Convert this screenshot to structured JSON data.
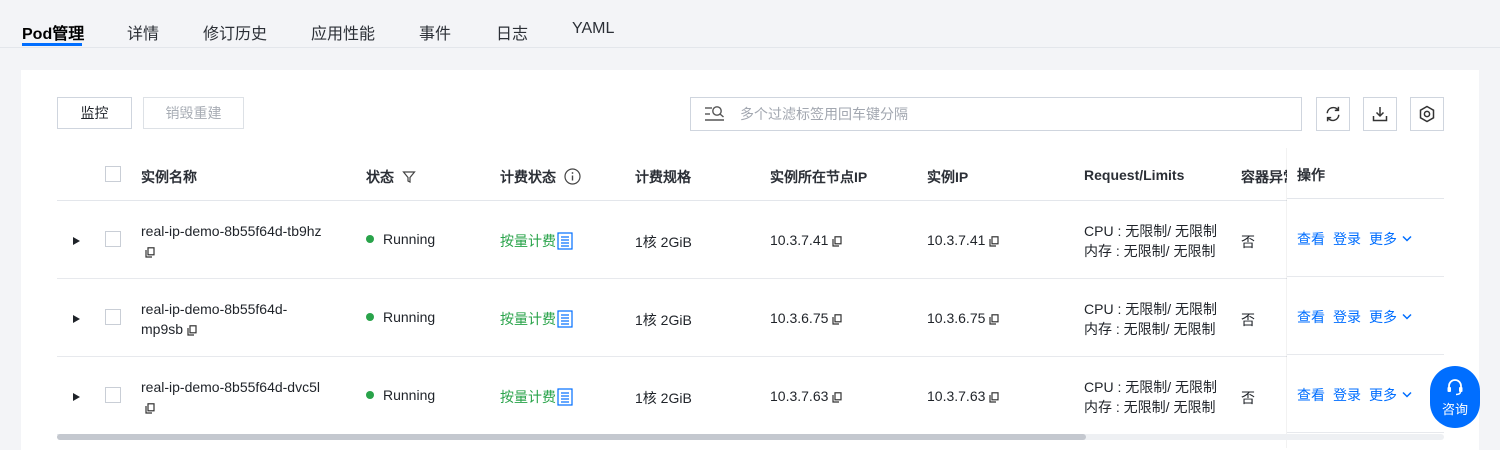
{
  "tabs": [
    "Pod管理",
    "详情",
    "修订历史",
    "应用性能",
    "事件",
    "日志",
    "YAML"
  ],
  "toolbar": {
    "monitor_label": "监控",
    "destroy_label": "销毁重建",
    "search_placeholder": "多个过滤标签用回车键分隔"
  },
  "columns": {
    "name": "实例名称",
    "status": "状态",
    "billing_status": "计费状态",
    "billing_spec": "计费规格",
    "node_ip": "实例所在节点IP",
    "instance_ip": "实例IP",
    "request_limits": "Request/Limits",
    "container_abnormal": "容器异常",
    "actions": "操作"
  },
  "rows": [
    {
      "name_line1": "real-ip-demo-8b55f64d-tb9hz",
      "name_line2": "",
      "status": "Running",
      "billing": "按量计费",
      "spec": "1核 2GiB",
      "node_ip": "10.3.7.41",
      "instance_ip": "10.3.7.41",
      "cpu": "CPU : 无限制/ 无限制",
      "mem": "内存 : 无限制/ 无限制",
      "abnormal": "否"
    },
    {
      "name_line1": "real-ip-demo-8b55f64d-",
      "name_line2": "mp9sb",
      "status": "Running",
      "billing": "按量计费",
      "spec": "1核 2GiB",
      "node_ip": "10.3.6.75",
      "instance_ip": "10.3.6.75",
      "cpu": "CPU : 无限制/ 无限制",
      "mem": "内存 : 无限制/ 无限制",
      "abnormal": "否"
    },
    {
      "name_line1": "real-ip-demo-8b55f64d-dvc5l",
      "name_line2": "",
      "status": "Running",
      "billing": "按量计费",
      "spec": "1核 2GiB",
      "node_ip": "10.3.7.63",
      "instance_ip": "10.3.7.63",
      "cpu": "CPU : 无限制/ 无限制",
      "mem": "内存 : 无限制/ 无限制",
      "abnormal": "否"
    }
  ],
  "row_actions": {
    "view": "查看",
    "login": "登录",
    "more": "更多"
  },
  "consult_label": "咨询",
  "colors": {
    "accent": "#006eff",
    "running": "#29a34a",
    "billing_text": "#29a34a"
  }
}
